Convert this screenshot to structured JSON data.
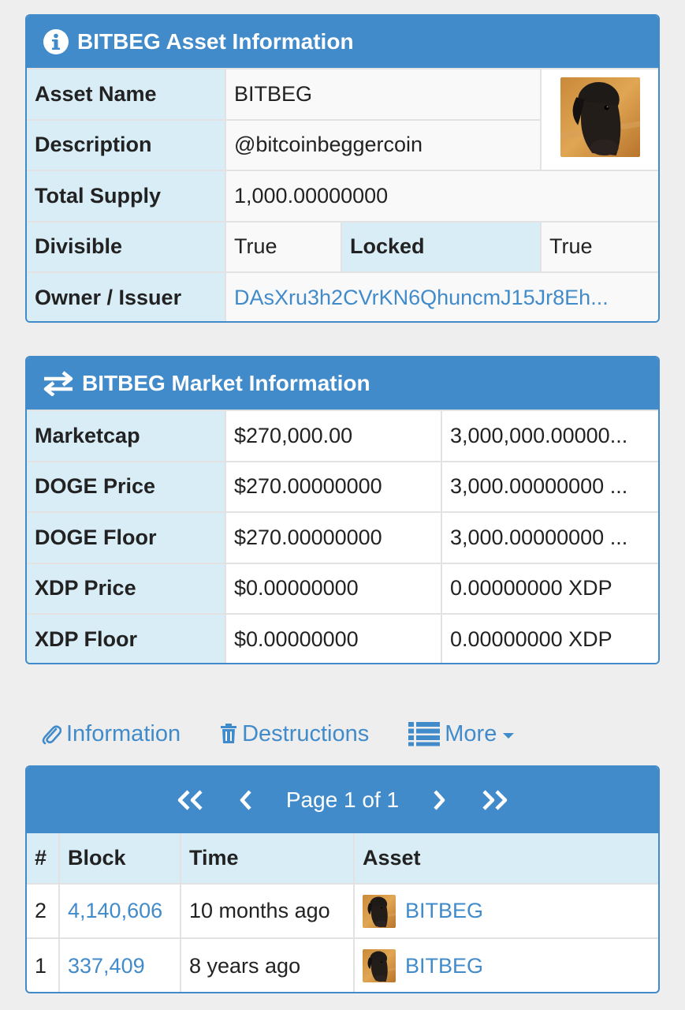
{
  "asset_panel": {
    "title": "BITBEG Asset Information",
    "rows": {
      "name_label": "Asset Name",
      "name_value": "BITBEG",
      "desc_label": "Description",
      "desc_value": "@bitcoinbeggercoin",
      "supply_label": "Total Supply",
      "supply_value": "1,000.00000000",
      "divisible_label": "Divisible",
      "divisible_value": "True",
      "locked_label": "Locked",
      "locked_value": "True",
      "owner_label": "Owner / Issuer",
      "owner_value": "DAsXru3h2CVrKN6QhuncmJ15Jr8Eh..."
    },
    "icon": "info-circle-icon"
  },
  "market_panel": {
    "title": "BITBEG Market Information",
    "icon": "exchange-arrows-icon",
    "rows": [
      {
        "label": "Marketcap",
        "usd": "$270,000.00",
        "native": "3,000,000.00000..."
      },
      {
        "label": "DOGE Price",
        "usd": "$270.00000000",
        "native": "3,000.00000000 ..."
      },
      {
        "label": "DOGE Floor",
        "usd": "$270.00000000",
        "native": "3,000.00000000 ..."
      },
      {
        "label": "XDP Price",
        "usd": "$0.00000000",
        "native": "0.00000000 XDP"
      },
      {
        "label": "XDP Floor",
        "usd": "$0.00000000",
        "native": "0.00000000 XDP"
      }
    ]
  },
  "tabs": {
    "information": "Information",
    "destructions": "Destructions",
    "more": "More"
  },
  "history": {
    "pager_label": "Page 1 of 1",
    "columns": [
      "#",
      "Block",
      "Time",
      "Asset"
    ],
    "rows": [
      {
        "num": "2",
        "block": "4,140,606",
        "time": "10 months ago",
        "asset": "BITBEG"
      },
      {
        "num": "1",
        "block": "337,409",
        "time": "8 years ago",
        "asset": "BITBEG"
      }
    ]
  },
  "colors": {
    "primary": "#428bca",
    "label_bg": "#d9edf7",
    "page_bg": "#eeeeee"
  }
}
